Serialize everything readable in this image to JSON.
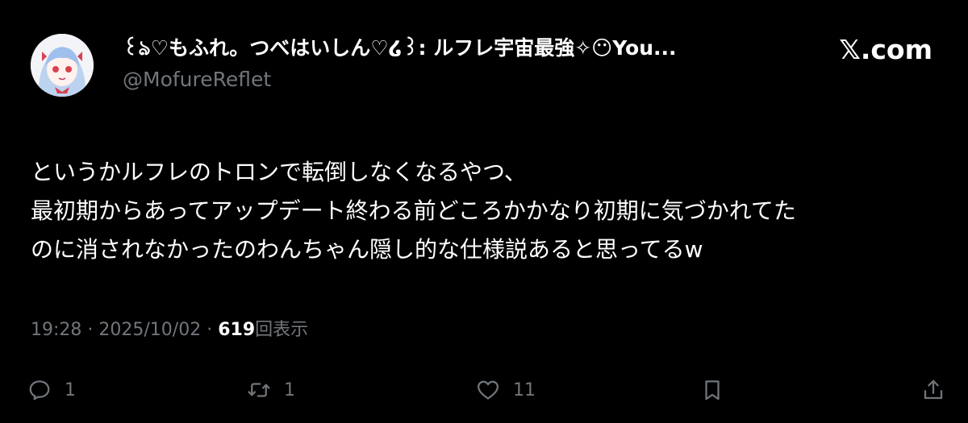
{
  "header": {
    "display_name": "꒰ঌ♡もふれ。つべはいしん♡໒꒱: ルフレ宇宙最強✧😶You...",
    "handle": "@MofureReflet",
    "brand": "𝕏.com"
  },
  "tweet": {
    "lines": [
      "というかルフレのトロンで転倒しなくなるやつ、",
      "最初期からあってアップデート終わる前どころかかなり初期に気づかれてた",
      "のに消されなかったのわんちゃん隠し的な仕様説あると思ってるw"
    ]
  },
  "meta": {
    "time": "19:28",
    "separator": "·",
    "date": "2025/10/02",
    "views_count": "619",
    "views_label": "回表示"
  },
  "actions": {
    "reply_count": "1",
    "retweet_count": "1",
    "like_count": "11"
  },
  "colors": {
    "background": "#000000",
    "text": "#ffffff",
    "secondary": "#71767b"
  },
  "icons": [
    "avatar-image",
    "reply-icon",
    "retweet-icon",
    "like-icon",
    "bookmark-icon",
    "share-icon"
  ]
}
